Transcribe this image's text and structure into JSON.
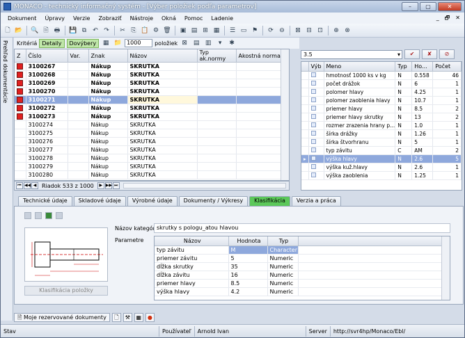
{
  "window": {
    "title": "MONACO - technický informačný systém - [Výber položiek podľa parametrov]"
  },
  "menu": [
    "Dokument",
    "Úpravy",
    "Verzie",
    "Zobraziť",
    "Nástroje",
    "Okná",
    "Pomoc",
    "Ladenie"
  ],
  "sidebar": {
    "label": "Prehľad dokumentácie"
  },
  "filter": {
    "kriteria": "Kritériá",
    "detaily": "Detaily",
    "dovybery": "Dovýbery",
    "count": "1000",
    "poloziek": "položiek"
  },
  "left_grid": {
    "columns": [
      "Z",
      "Číslo",
      "Var.",
      "Znak",
      "Názov",
      "Typ ak.normy",
      "Akostná norma"
    ],
    "rows": [
      {
        "flag": true,
        "cislo": "3100267",
        "znak": "Nákup",
        "nazov": "SKRUTKA",
        "bold": true
      },
      {
        "flag": true,
        "cislo": "3100268",
        "znak": "Nákup",
        "nazov": "SKRUTKA",
        "bold": true
      },
      {
        "flag": true,
        "cislo": "3100269",
        "znak": "Nákup",
        "nazov": "SKRUTKA",
        "bold": true
      },
      {
        "flag": true,
        "cislo": "3100270",
        "znak": "Nákup",
        "nazov": "SKRUTKA",
        "bold": true
      },
      {
        "flag": true,
        "cislo": "3100271",
        "znak": "Nákup",
        "nazov": "SKRUTKA",
        "bold": true,
        "selected": true
      },
      {
        "flag": true,
        "cislo": "3100272",
        "znak": "Nákup",
        "nazov": "SKRUTKA",
        "bold": true
      },
      {
        "flag": true,
        "cislo": "3100273",
        "znak": "Nákup",
        "nazov": "SKRUTKA",
        "bold": true
      },
      {
        "flag": false,
        "cislo": "3100274",
        "znak": "Nákup",
        "nazov": "SKRUTKA"
      },
      {
        "flag": false,
        "cislo": "3100275",
        "znak": "Nákup",
        "nazov": "SKRUTKA"
      },
      {
        "flag": false,
        "cislo": "3100276",
        "znak": "Nákup",
        "nazov": "SKRUTKA"
      },
      {
        "flag": false,
        "cislo": "3100277",
        "znak": "Nákup",
        "nazov": "SKRUTKA"
      },
      {
        "flag": false,
        "cislo": "3100278",
        "znak": "Nákup",
        "nazov": "SKRUTKA"
      },
      {
        "flag": false,
        "cislo": "3100279",
        "znak": "Nákup",
        "nazov": "SKRUTKA"
      },
      {
        "flag": false,
        "cislo": "3100280",
        "znak": "Nákup",
        "nazov": "SKRUTKA"
      }
    ],
    "nav_text": "Riadok 533 z 1000"
  },
  "right": {
    "combo_value": "3.5",
    "columns": [
      "Výb",
      "Meno",
      "Typ",
      "Ho...",
      "Počet"
    ],
    "rows": [
      {
        "meno": "hmotnosť 1000 ks v kg",
        "typ": "N",
        "ho": "0.558",
        "pocet": "46"
      },
      {
        "meno": "počet drážok",
        "typ": "N",
        "ho": "6",
        "pocet": "1"
      },
      {
        "meno": "polomer hlavy",
        "typ": "N",
        "ho": "4.25",
        "pocet": "1"
      },
      {
        "meno": "polomer zaoblenia hlavy",
        "typ": "N",
        "ho": "10.7",
        "pocet": "1"
      },
      {
        "meno": "priemer hlavy",
        "typ": "N",
        "ho": "8.5",
        "pocet": "2"
      },
      {
        "meno": "priemer hlavy skrutky",
        "typ": "N",
        "ho": "13",
        "pocet": "2"
      },
      {
        "meno": "rozmer zrazenia hrany p...",
        "typ": "N",
        "ho": "1.0",
        "pocet": "1"
      },
      {
        "meno": "šírka drážky",
        "typ": "N",
        "ho": "1.26",
        "pocet": "1"
      },
      {
        "meno": "šírka štvorhranu",
        "typ": "N",
        "ho": "5",
        "pocet": "1"
      },
      {
        "meno": "typ závitu",
        "typ": "C",
        "ho": "AM",
        "pocet": "2"
      },
      {
        "meno": "výška hlavy",
        "typ": "N",
        "ho": "2.6",
        "pocet": "5",
        "selected": true
      },
      {
        "meno": "výška kuž.hlavy",
        "typ": "N",
        "ho": "2.6",
        "pocet": "1"
      },
      {
        "meno": "výška zaoblenia",
        "typ": "N",
        "ho": "1.25",
        "pocet": "1"
      }
    ]
  },
  "tabs": [
    "Technické údaje",
    "Skladové údaje",
    "Výrobné údaje",
    "Dokumenty / Výkresy",
    "Klasifikácia",
    "Verzia a práca"
  ],
  "active_tab": "Klasifikácia",
  "panel": {
    "nazov_kategorie_label": "Názov kategórie",
    "nazov_kategorie_value": "skrutky s pologu_atou hlavou",
    "parametre_label": "Parametre",
    "klasifikacia_button": "Klasifikácia položky",
    "param_columns": [
      "Názov",
      "Hodnota",
      "Typ"
    ],
    "params": [
      {
        "nazov": "typ závitu",
        "hodnota": "M",
        "typ": "Character",
        "hi": true
      },
      {
        "nazov": "priemer závitu",
        "hodnota": "5",
        "typ": "Numeric"
      },
      {
        "nazov": "dĺžka skrutky",
        "hodnota": "35",
        "typ": "Numeric"
      },
      {
        "nazov": "dĺžka závitu",
        "hodnota": "16",
        "typ": "Numeric"
      },
      {
        "nazov": "priemer hlavy",
        "hodnota": "8.5",
        "typ": "Numeric"
      },
      {
        "nazov": "výška hlavy",
        "hodnota": "4.2",
        "typ": "Numeric"
      }
    ]
  },
  "bottom": {
    "tab": "Moje rezervované dokumenty"
  },
  "status": {
    "stav": "Stav",
    "user_label": "Používateľ",
    "user": "Arnold Ivan",
    "server_label": "Server",
    "server": "http://svr4hp/Monaco/Ebl/"
  }
}
